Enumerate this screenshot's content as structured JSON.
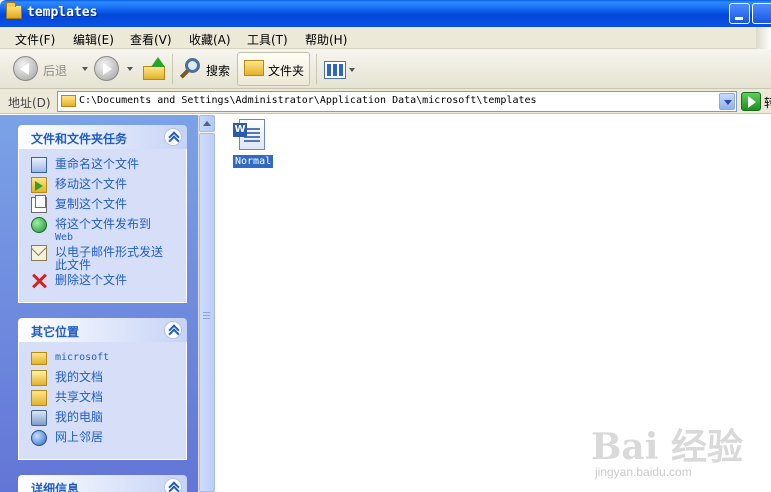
{
  "window": {
    "title": "templates"
  },
  "menu": {
    "items": [
      "文件(F)",
      "编辑(E)",
      "查看(V)",
      "收藏(A)",
      "工具(T)",
      "帮助(H)"
    ]
  },
  "toolbar": {
    "back_label": "后退",
    "search_label": "搜索",
    "folders_label": "文件夹"
  },
  "address": {
    "label": "地址(D)",
    "value": "C:\\Documents and Settings\\Administrator\\Application Data\\microsoft\\templates",
    "go_label": "转"
  },
  "task_pane": {
    "file_tasks": {
      "title": "文件和文件夹任务",
      "items": [
        {
          "label": "重命名这个文件",
          "icon": "rename-icon"
        },
        {
          "label": "移动这个文件",
          "icon": "move-icon"
        },
        {
          "label": "复制这个文件",
          "icon": "copy-icon"
        },
        {
          "label": "将这个文件发布到",
          "label2": "Web",
          "icon": "publish-web-icon"
        },
        {
          "label": "以电子邮件形式发送",
          "label2": "此文件",
          "icon": "email-icon"
        },
        {
          "label": "删除这个文件",
          "icon": "delete-icon"
        }
      ]
    },
    "other_places": {
      "title": "其它位置",
      "items": [
        {
          "label": "microsoft",
          "icon": "folder-icon"
        },
        {
          "label": "我的文档",
          "icon": "my-documents-icon"
        },
        {
          "label": "共享文档",
          "icon": "shared-documents-icon"
        },
        {
          "label": "我的电脑",
          "icon": "my-computer-icon"
        },
        {
          "label": "网上邻居",
          "icon": "network-icon"
        }
      ]
    },
    "details": {
      "title": "详细信息"
    }
  },
  "files": [
    {
      "name": "Normal",
      "icon": "word-document-icon",
      "selected": true
    }
  ],
  "watermark": {
    "logo": "Bai 经验",
    "sub": "jingyan.baidu.com"
  },
  "colors": {
    "titlebar": "#0a52e6",
    "task_pane_bg": "#6f8ee0",
    "panel_title": "#215dc6",
    "selection": "#316ac5"
  }
}
